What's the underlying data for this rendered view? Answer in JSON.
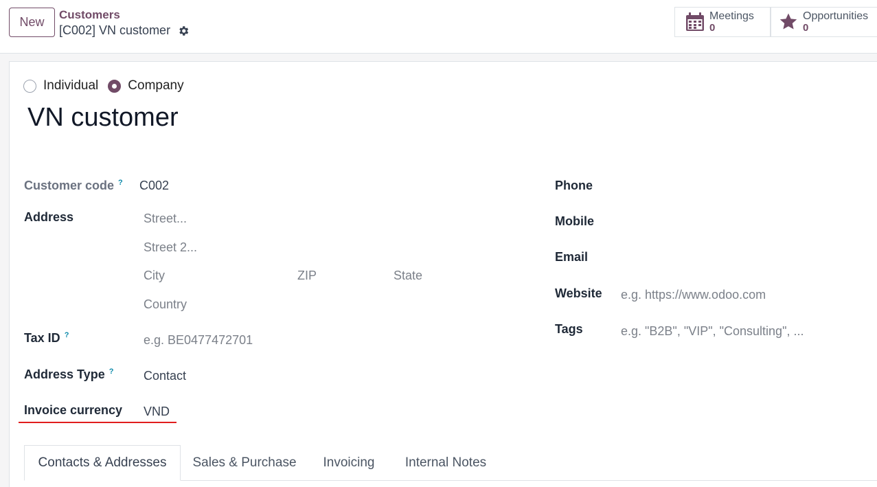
{
  "header": {
    "new_button": "New",
    "breadcrumb_parent": "Customers",
    "breadcrumb_current": "[C002] VN customer"
  },
  "smart_buttons": [
    {
      "label": "Meetings",
      "value": "0",
      "icon": "calendar-icon"
    },
    {
      "label": "Opportunities",
      "value": "0",
      "icon": "star-icon"
    }
  ],
  "partner_type": {
    "options": [
      "Individual",
      "Company"
    ],
    "selected": "Company"
  },
  "record": {
    "name": "VN customer"
  },
  "left_fields": {
    "customer_code_label": "Customer code",
    "customer_code_value": "C002",
    "address_label": "Address",
    "street_ph": "Street...",
    "street2_ph": "Street 2...",
    "city_ph": "City",
    "zip_ph": "ZIP",
    "state_ph": "State",
    "country_ph": "Country",
    "tax_id_label": "Tax ID",
    "tax_id_ph": "e.g. BE0477472701",
    "address_type_label": "Address Type",
    "address_type_value": "Contact",
    "invoice_currency_label": "Invoice currency",
    "invoice_currency_value": "VND"
  },
  "right_fields": {
    "phone_label": "Phone",
    "mobile_label": "Mobile",
    "email_label": "Email",
    "website_label": "Website",
    "website_ph": "e.g. https://www.odoo.com",
    "tags_label": "Tags",
    "tags_ph": "e.g. \"B2B\", \"VIP\", \"Consulting\", ..."
  },
  "tabs": [
    {
      "label": "Contacts & Addresses",
      "active": true
    },
    {
      "label": "Sales & Purchase",
      "active": false
    },
    {
      "label": "Invoicing",
      "active": false
    },
    {
      "label": "Internal Notes",
      "active": false
    }
  ],
  "colors": {
    "brand": "#714b67",
    "highlight_underline": "#e11d1d",
    "help_icon": "#0d8aaa"
  }
}
